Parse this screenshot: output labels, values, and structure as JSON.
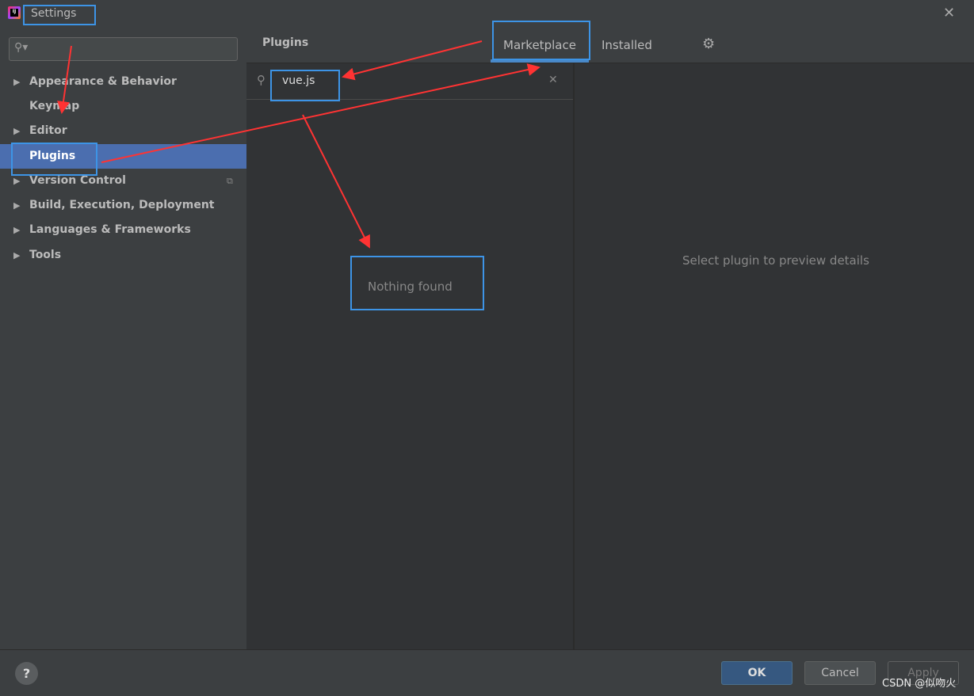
{
  "window": {
    "title": "Settings",
    "close_icon": "close-icon",
    "app_icon_text": "IJ"
  },
  "sidebar": {
    "search_placeholder": "",
    "items": [
      {
        "label": "Appearance & Behavior",
        "expandable": true
      },
      {
        "label": "Keymap",
        "expandable": false
      },
      {
        "label": "Editor",
        "expandable": true
      },
      {
        "label": "Plugins",
        "expandable": false,
        "selected": true
      },
      {
        "label": "Version Control",
        "expandable": true
      },
      {
        "label": "Build, Execution, Deployment",
        "expandable": true
      },
      {
        "label": "Languages & Frameworks",
        "expandable": true
      },
      {
        "label": "Tools",
        "expandable": true
      }
    ]
  },
  "header": {
    "title": "Plugins",
    "tabs": [
      {
        "label": "Marketplace",
        "active": true
      },
      {
        "label": "Installed",
        "active": false
      }
    ],
    "gear_icon": "gear-icon"
  },
  "search": {
    "value": "vue.js"
  },
  "results": {
    "empty_text": "Nothing found"
  },
  "detail": {
    "placeholder": "Select plugin to preview details"
  },
  "footer": {
    "help": "?",
    "ok": "OK",
    "cancel": "Cancel",
    "apply": "Apply"
  },
  "watermark": "CSDN @似吻火",
  "colors": {
    "selection": "#4b6eaf",
    "annotation_box": "#3d94e6",
    "annotation_arrow": "#ff3333"
  }
}
